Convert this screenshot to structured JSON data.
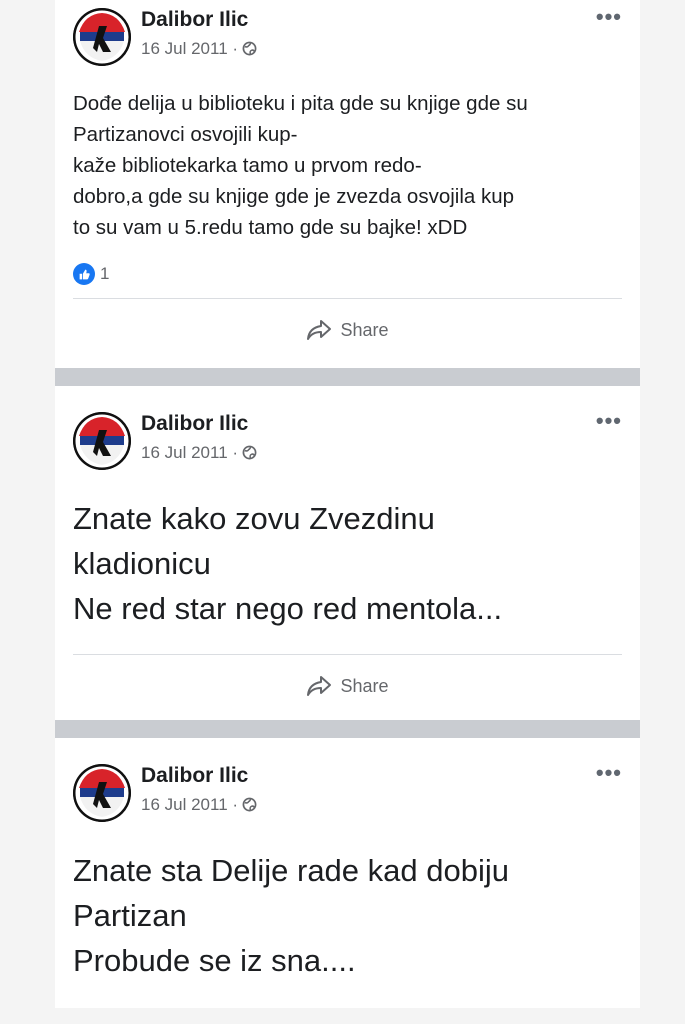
{
  "posts": [
    {
      "author": "Dalibor Ilic",
      "date": "16 Jul 2011 ·",
      "more": "•••",
      "lines": [
        "Dođe delija u biblioteku i pita gde su knjige gde su",
        "Partizanovci osvojili kup-",
        "kaže bibliotekarka tamo u prvom redo-",
        "dobro,a gde su knjige gde je zvezda osvojila kup",
        "to su vam u 5.redu tamo gde su bajke! xDD"
      ],
      "reaction_count": "1",
      "share_label": "Share"
    },
    {
      "author": "Dalibor Ilic",
      "date": "16 Jul 2011 ·",
      "more": "•••",
      "lines": [
        "Znate kako zovu Zvezdinu",
        "kladionicu",
        "Ne red star nego red mentola..."
      ],
      "share_label": "Share"
    },
    {
      "author": "Dalibor Ilic",
      "date": "16 Jul 2011 ·",
      "more": "•••",
      "lines": [
        "Znate sta Delije rade kad dobiju",
        "Partizan",
        "Probude se iz sna...."
      ]
    }
  ],
  "icons": {
    "avatar": "avatar",
    "privacy": "globe-icon",
    "more": "more-options-icon",
    "like": "like-icon",
    "share": "share-icon"
  },
  "colors": {
    "like_blue": "#1877f2",
    "secondary_text": "#65676b",
    "separator": "#c9ccd1"
  }
}
